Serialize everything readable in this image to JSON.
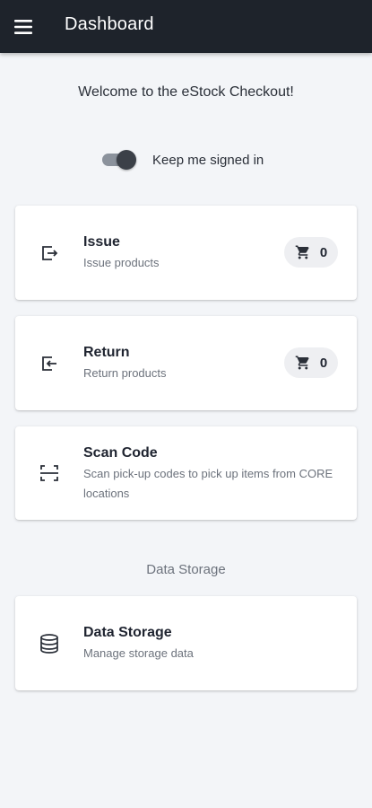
{
  "appbar": {
    "title": "Dashboard",
    "menu_icon": "hamburger-menu-icon"
  },
  "welcome_text": "Welcome to the eStock Checkout!",
  "keep_signed_in": {
    "label": "Keep me signed in",
    "enabled": true
  },
  "cards": [
    {
      "title": "Issue",
      "subtitle": "Issue products",
      "icon": "issue-icon",
      "cart_count": "0"
    },
    {
      "title": "Return",
      "subtitle": "Return products",
      "icon": "return-icon",
      "cart_count": "0"
    },
    {
      "title": "Scan Code",
      "subtitle": "Scan pick-up codes to pick up items from CORE locations",
      "icon": "scan-code-icon"
    }
  ],
  "data_storage_section": {
    "label": "Data Storage",
    "card": {
      "title": "Data Storage",
      "subtitle": "Manage storage data",
      "icon": "database-icon"
    }
  },
  "colors": {
    "appbar_bg": "#1e232b",
    "page_bg": "#f3f5f8",
    "card_bg": "#ffffff",
    "chip_bg": "#eeeff2"
  }
}
